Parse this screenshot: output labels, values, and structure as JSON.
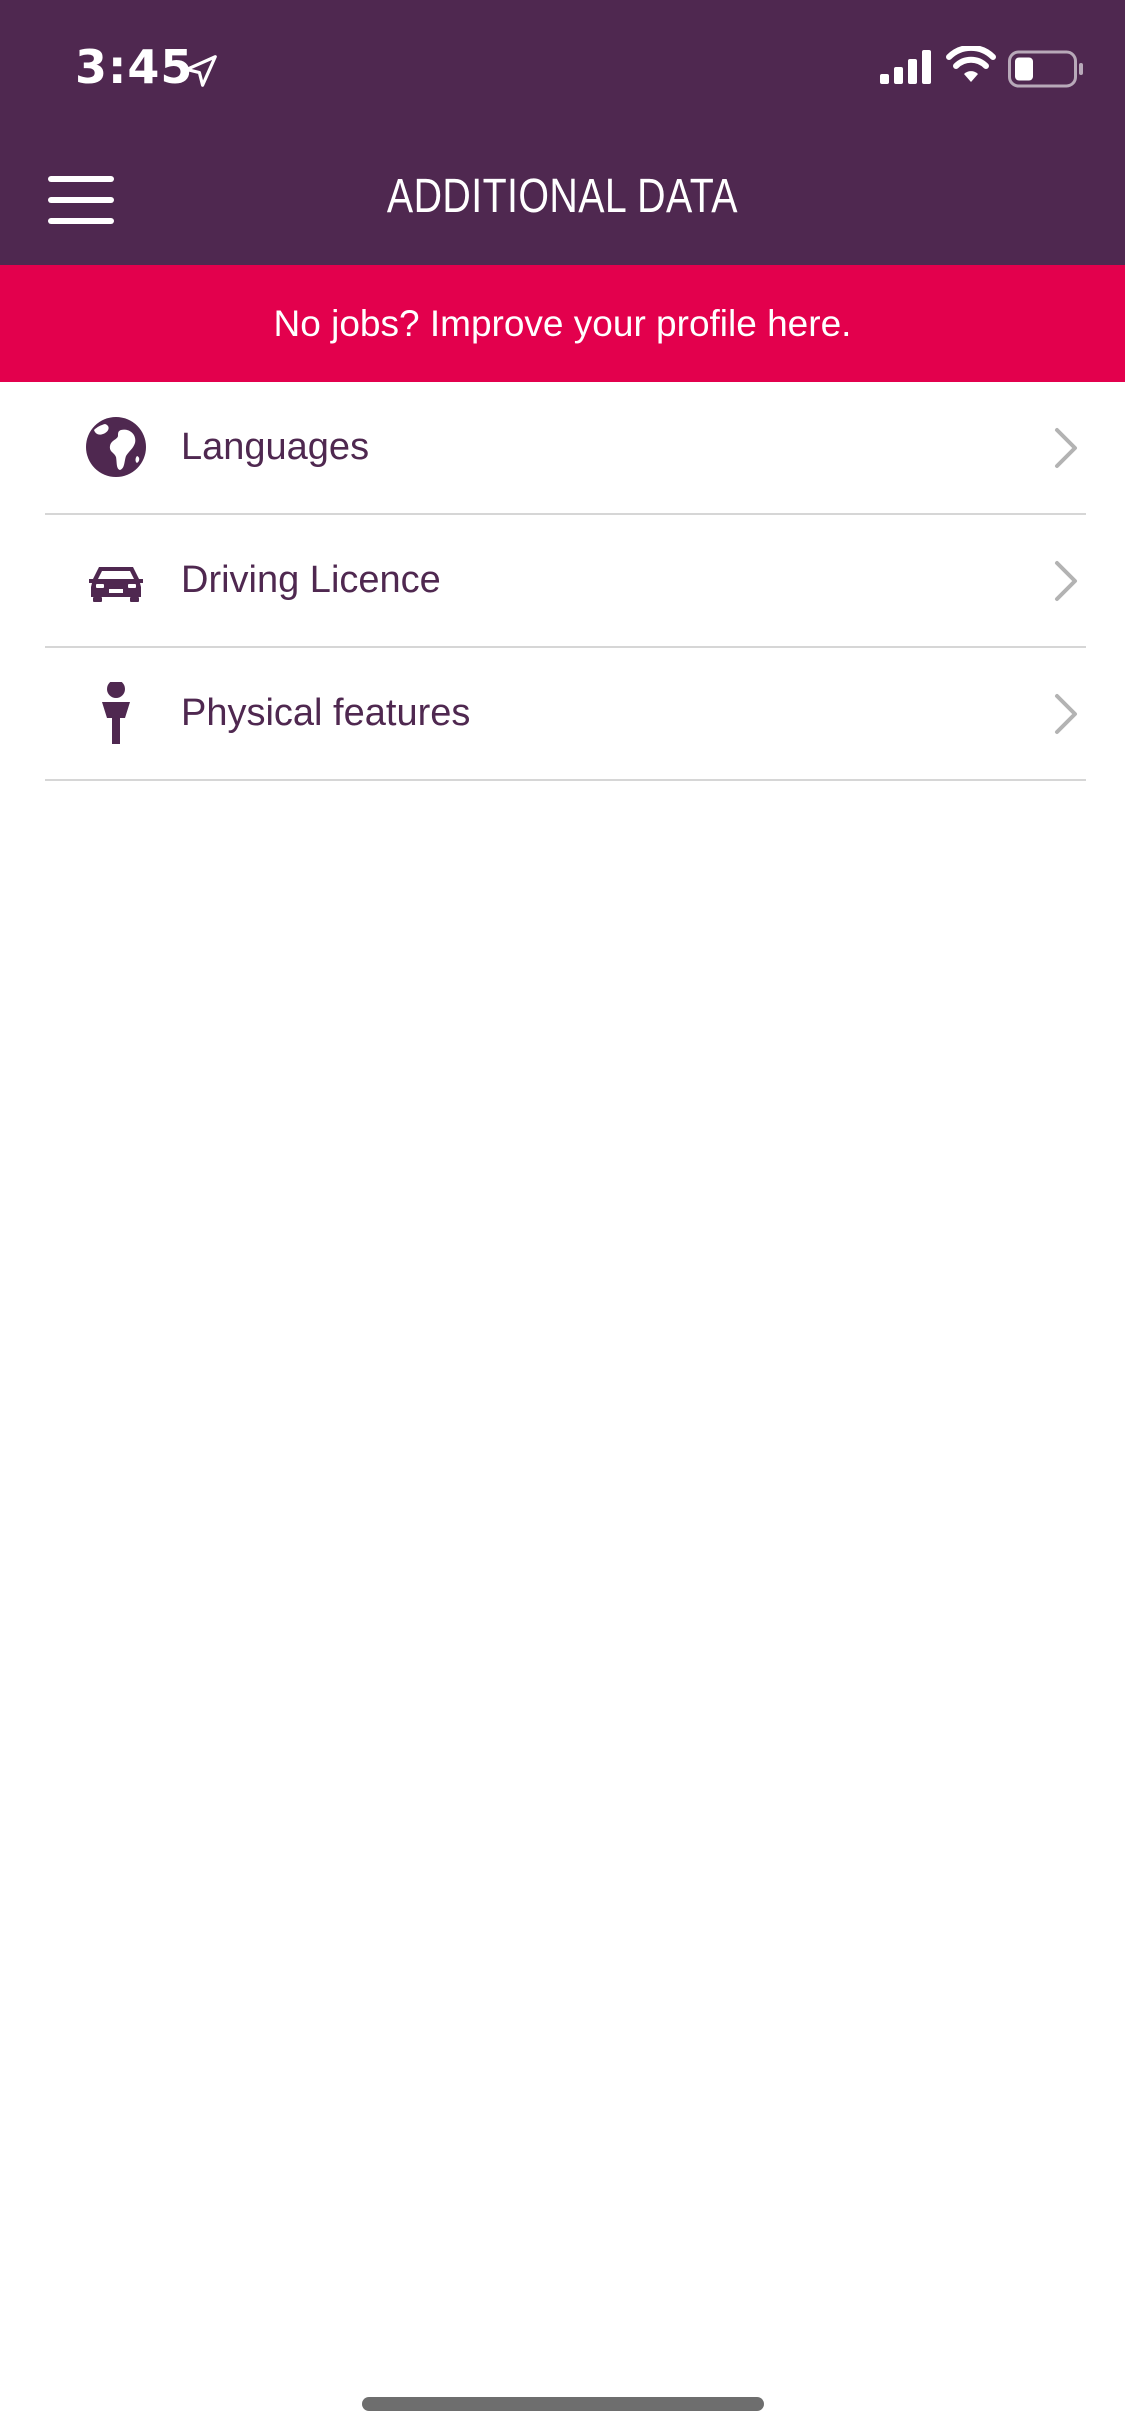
{
  "status_bar": {
    "time": "3:45",
    "icons": [
      "location-arrow-icon",
      "signal-icon",
      "wifi-icon",
      "battery-icon"
    ]
  },
  "header": {
    "title": "ADDITIONAL DATA",
    "menu_icon": "hamburger-menu-icon"
  },
  "banner": {
    "text": "No jobs? Improve your profile here."
  },
  "items": [
    {
      "label": "Languages",
      "icon": "globe-icon"
    },
    {
      "label": "Driving Licence",
      "icon": "car-icon"
    },
    {
      "label": "Physical features",
      "icon": "person-icon"
    }
  ],
  "colors": {
    "header_bg": "#4f2850",
    "banner_bg": "#e3004d",
    "text_primary": "#4f2850",
    "divider": "#d6d6d6",
    "chevron": "#b3b3b3"
  }
}
